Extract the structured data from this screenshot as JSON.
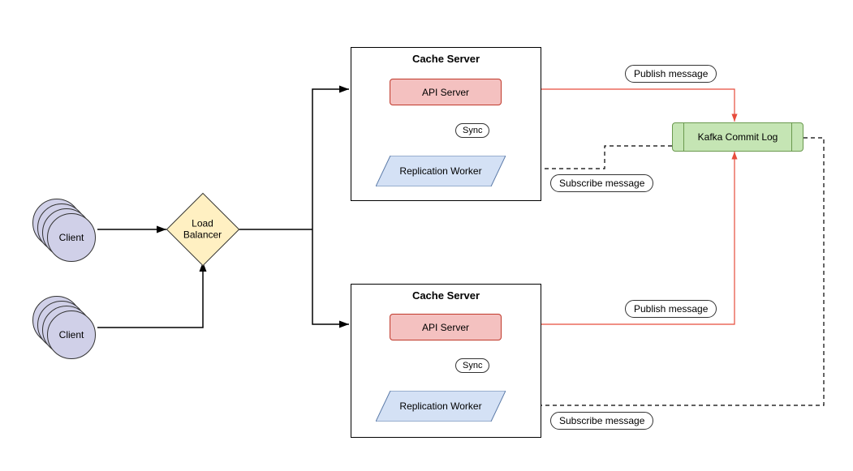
{
  "clients": {
    "label_top": "Client",
    "label_bottom": "Client"
  },
  "load_balancer": {
    "label": "Load\nBalancer"
  },
  "cache_server_1": {
    "title": "Cache Server",
    "api_server": "API Server",
    "sync": "Sync",
    "replication_worker": "Replication Worker"
  },
  "cache_server_2": {
    "title": "Cache Server",
    "api_server": "API Server",
    "sync": "Sync",
    "replication_worker": "Replication Worker"
  },
  "kafka": {
    "label": "Kafka Commit Log"
  },
  "labels": {
    "publish_1": "Publish message",
    "subscribe_1": "Subscribe message",
    "publish_2": "Publish message",
    "subscribe_2": "Subscribe message"
  },
  "colors": {
    "api_border": "#c0392b",
    "api_fill": "#f4c1c0",
    "repl_fill": "#d4e1f5",
    "kafka_fill": "#c5e5b4",
    "client_fill": "#d0d0e8",
    "lb_fill": "#fff0c2",
    "red_arrow": "#e74c3c"
  }
}
